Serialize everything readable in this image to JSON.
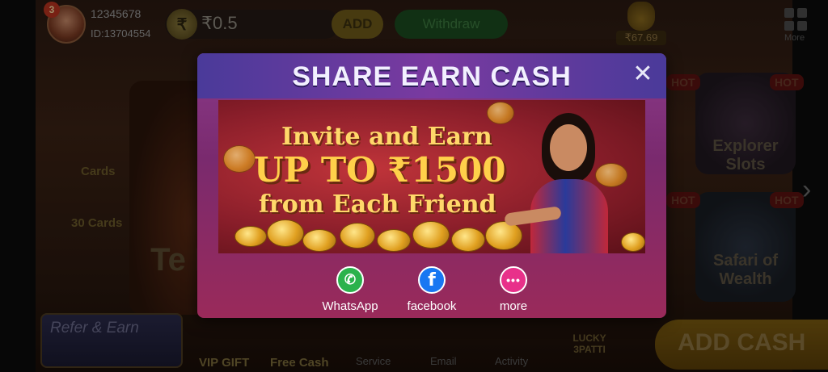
{
  "lobby": {
    "user_name": "12345678",
    "user_id": "ID:13704554",
    "level": "3",
    "balance": "₹0.5",
    "rupee_symbol": "₹",
    "add_label": "ADD",
    "withdraw_label": "Withdraw",
    "pot_value": "₹67.69",
    "more_label": "More",
    "hot_label": "HOT",
    "explorer_label": "Explorer Slots",
    "safari_label": "Safari of Wealth",
    "cards_label": "Cards",
    "cards30_label": "30 Cards",
    "left_game_label": "Te Pa",
    "refer_earn_label": "Refer & Earn",
    "bottom_nav": [
      "VIP GIFT",
      "Free Cash",
      "Service",
      "Email",
      "Activity",
      "LUCKY 3PATTI"
    ],
    "add_cash_label": "ADD CASH"
  },
  "modal": {
    "title": "SHARE EARN CASH",
    "close_symbol": "✕",
    "banner": {
      "line1": "Invite and Earn",
      "line2": "UP TO ₹1500",
      "line3": "from Each Friend"
    },
    "share_options": [
      {
        "label": "WhatsApp",
        "icon": "whatsapp-icon",
        "glyph": "✆",
        "color": "#2bb24c"
      },
      {
        "label": "facebook",
        "icon": "facebook-icon",
        "glyph": "f",
        "color": "#1877f2"
      },
      {
        "label": "more",
        "icon": "more-icon",
        "glyph": "•••",
        "color": "#e8308a"
      }
    ]
  }
}
